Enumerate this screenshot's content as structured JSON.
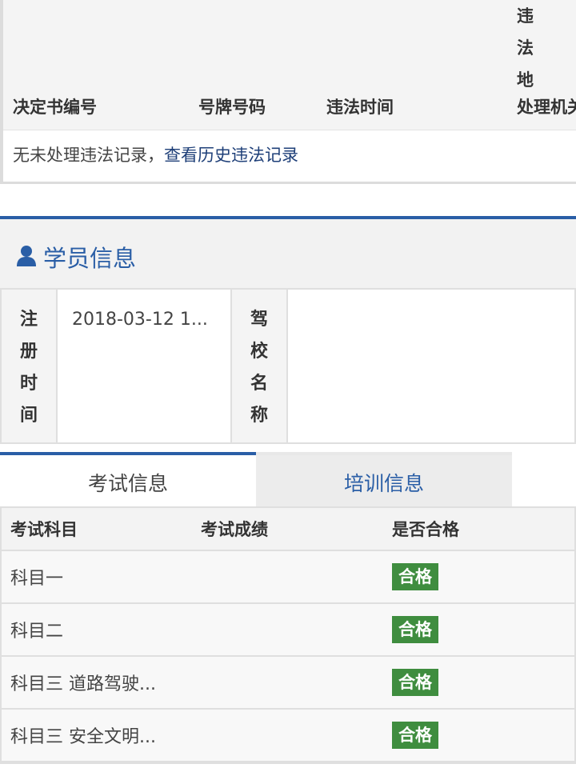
{
  "violations": {
    "columns": {
      "decision_no": "决定书编号",
      "plate": "号牌号码",
      "time": "违法时间",
      "vertical": [
        "违",
        "法",
        "地"
      ],
      "authority": "处理机关"
    },
    "empty_text": "无未处理违法记录，",
    "history_link": "查看历史违法记录"
  },
  "student": {
    "section_title": "学员信息",
    "fields": [
      {
        "label": [
          "注",
          "册",
          "时",
          "间"
        ],
        "value": "2018-03-12 1..."
      },
      {
        "label": [
          "驾",
          "校",
          "名",
          "称"
        ],
        "value": ""
      }
    ]
  },
  "tabs": [
    {
      "label": "考试信息",
      "active": true
    },
    {
      "label": "培训信息",
      "active": false
    }
  ],
  "exam": {
    "headers": [
      "考试科目",
      "考试成绩",
      "是否合格"
    ],
    "rows": [
      {
        "subject": "科目一",
        "score": "",
        "result": "合格"
      },
      {
        "subject": "科目二",
        "score": "",
        "result": "合格"
      },
      {
        "subject": "科目三 道路驾驶...",
        "score": "",
        "result": "合格"
      },
      {
        "subject": "科目三 安全文明...",
        "score": "",
        "result": "合格"
      }
    ]
  },
  "colors": {
    "accent": "#2a5ea6",
    "pass_badge": "#3f8d3f"
  }
}
